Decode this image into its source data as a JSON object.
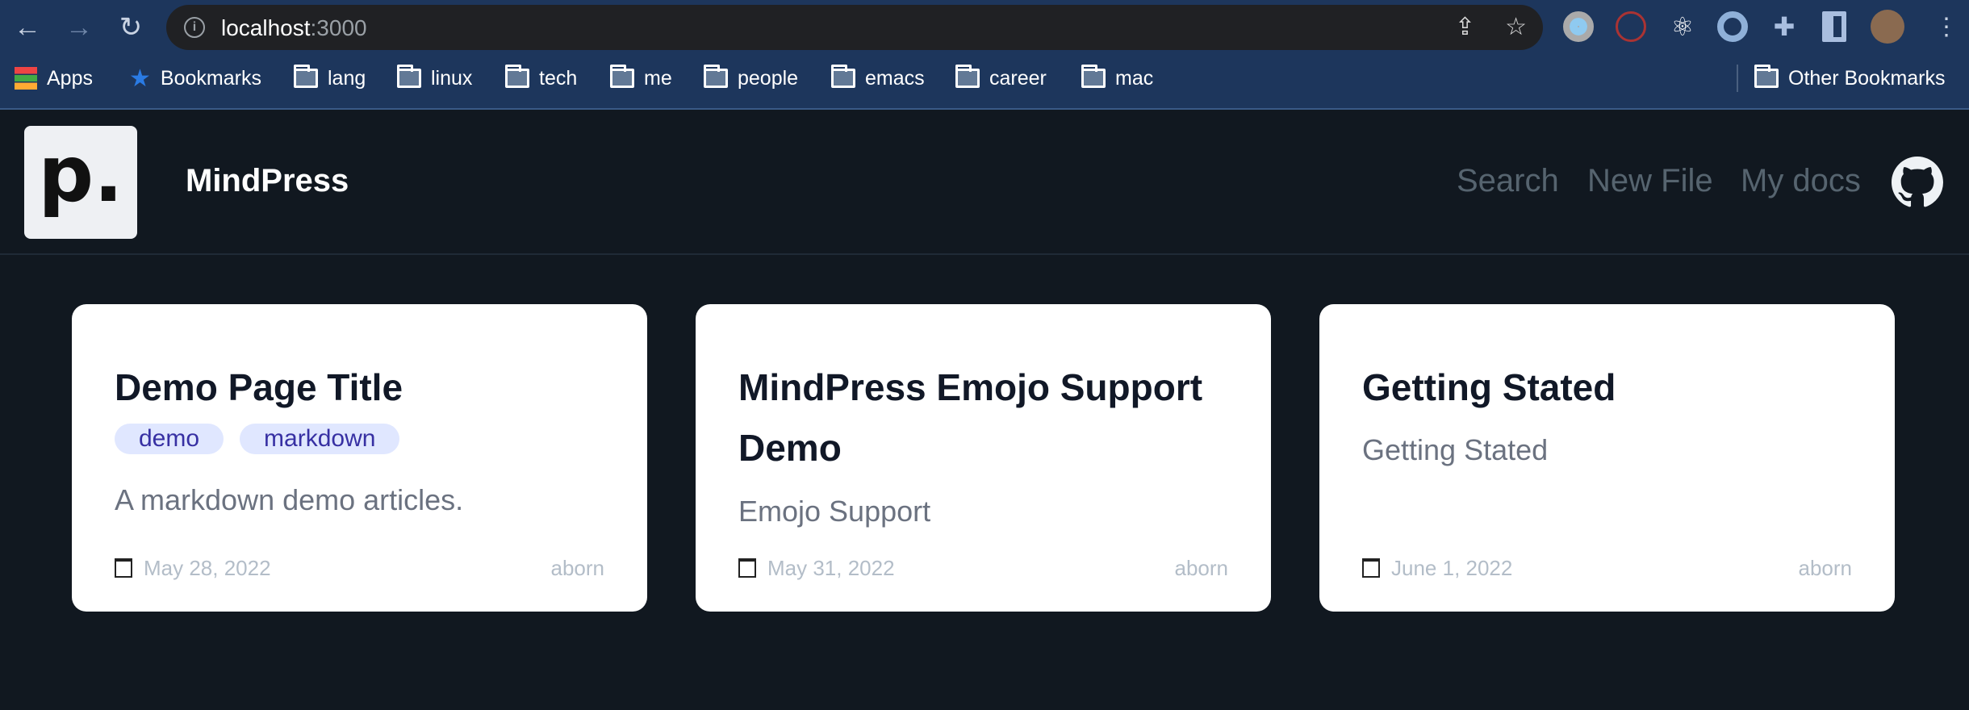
{
  "browser": {
    "url_host": "localhost",
    "url_port": ":3000",
    "bookmarks": [
      "Apps",
      "Bookmarks",
      "lang",
      "linux",
      "tech",
      "me",
      "people",
      "emacs",
      "career",
      "mac"
    ],
    "other_bookmarks": "Other Bookmarks"
  },
  "header": {
    "logo": "p.",
    "brand": "MindPress",
    "nav": [
      "Search",
      "New File",
      "My docs"
    ]
  },
  "cards": [
    {
      "title": "Demo Page Title",
      "tags": [
        "demo",
        "markdown"
      ],
      "description": "A markdown demo articles.",
      "date": "May 28, 2022",
      "author": "aborn"
    },
    {
      "title": "MindPress Emojo Support Demo",
      "tags": [],
      "description": "Emojo Support",
      "date": "May 31, 2022",
      "author": "aborn"
    },
    {
      "title": "Getting Stated",
      "tags": [],
      "description": "Getting Stated",
      "date": "June 1, 2022",
      "author": "aborn"
    }
  ]
}
